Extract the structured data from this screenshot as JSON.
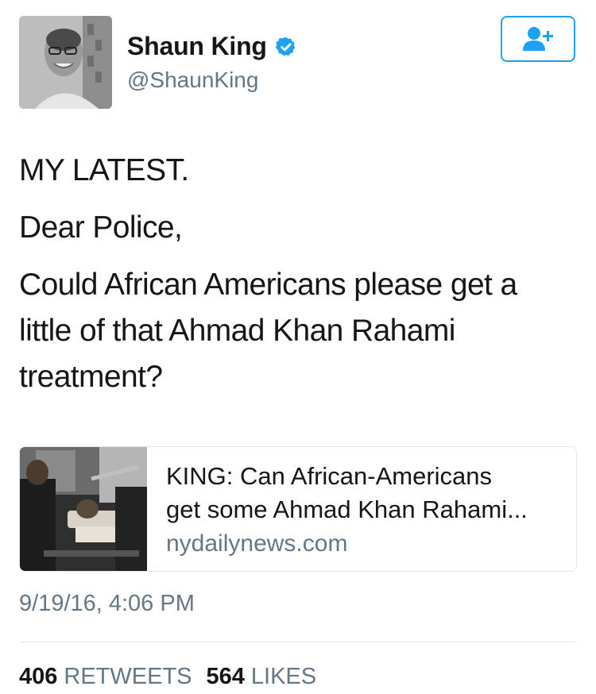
{
  "author": {
    "display_name": "Shaun King",
    "handle": "@ShaunKing",
    "verified": true,
    "avatar_icon": "profile-photo"
  },
  "follow_button": {
    "icon": "add-user-icon",
    "color": "#1da1f2"
  },
  "tweet": {
    "paragraphs": [
      "MY LATEST.",
      "Dear Police,",
      "Could African Americans please get a little of that Ahmad Khan Rahami treatment?"
    ]
  },
  "card": {
    "title": "KING: Can African-Americans\nget some Ahmad Khan Rahami...",
    "domain": "nydailynews.com",
    "image_icon": "news-photo"
  },
  "timestamp": "9/19/16, 4:06 PM",
  "stats": {
    "retweets_count": "406",
    "retweets_label": "RETWEETS",
    "likes_count": "564",
    "likes_label": "LIKES"
  },
  "colors": {
    "accent": "#1da1f2",
    "secondary_text": "#657786",
    "primary_text": "#14171a"
  }
}
